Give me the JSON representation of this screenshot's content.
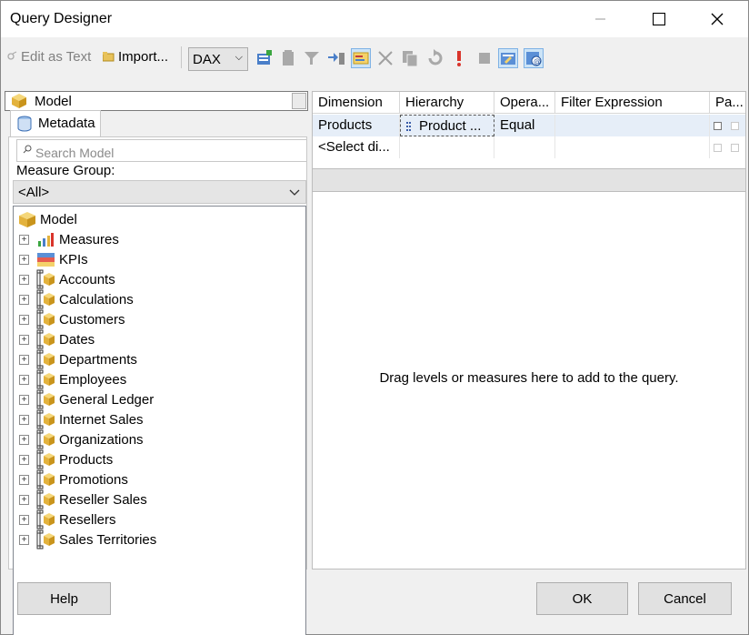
{
  "window": {
    "title": "Query Designer"
  },
  "toolbar": {
    "edit_as_text": "Edit as Text",
    "import": "Import...",
    "language": "DAX",
    "icons": [
      "add-calculated-member-icon",
      "delete-icon",
      "filter-icon",
      "show-empty-cells-icon",
      "auto-execute-icon",
      "remove-icon",
      "copy-icon",
      "refresh-icon",
      "run-icon",
      "cancel-query-icon",
      "design-mode-icon",
      "query-parameters-icon"
    ]
  },
  "left_panel": {
    "cube": "Model",
    "tab": "Metadata",
    "search_placeholder": "Search Model",
    "measure_group_label": "Measure Group:",
    "measure_group_value": "<All>",
    "tree_root": "Model",
    "tree_items": [
      {
        "label": "Measures",
        "icon": "measures-icon"
      },
      {
        "label": "KPIs",
        "icon": "kpi-icon"
      },
      {
        "label": "Accounts",
        "icon": "dimension-icon"
      },
      {
        "label": "Calculations",
        "icon": "dimension-icon"
      },
      {
        "label": "Customers",
        "icon": "dimension-icon"
      },
      {
        "label": "Dates",
        "icon": "dimension-icon"
      },
      {
        "label": "Departments",
        "icon": "dimension-icon"
      },
      {
        "label": "Employees",
        "icon": "dimension-icon"
      },
      {
        "label": "General Ledger",
        "icon": "dimension-icon"
      },
      {
        "label": "Internet Sales",
        "icon": "dimension-icon"
      },
      {
        "label": "Organizations",
        "icon": "dimension-icon"
      },
      {
        "label": "Products",
        "icon": "dimension-icon"
      },
      {
        "label": "Promotions",
        "icon": "dimension-icon"
      },
      {
        "label": "Reseller Sales",
        "icon": "dimension-icon"
      },
      {
        "label": "Resellers",
        "icon": "dimension-icon"
      },
      {
        "label": "Sales Territories",
        "icon": "dimension-icon"
      }
    ]
  },
  "filter_grid": {
    "columns": [
      "Dimension",
      "Hierarchy",
      "Opera...",
      "Filter Expression",
      "Pa..."
    ],
    "rows": [
      {
        "dimension": "Products",
        "hierarchy": "Product ...",
        "operator": "Equal",
        "filter_expression": ""
      },
      {
        "dimension": "<Select di...",
        "hierarchy": "",
        "operator": "",
        "filter_expression": ""
      }
    ]
  },
  "data_pane": {
    "hint": "Drag levels or measures here to add to the query."
  },
  "buttons": {
    "help": "Help",
    "ok": "OK",
    "cancel": "Cancel"
  }
}
